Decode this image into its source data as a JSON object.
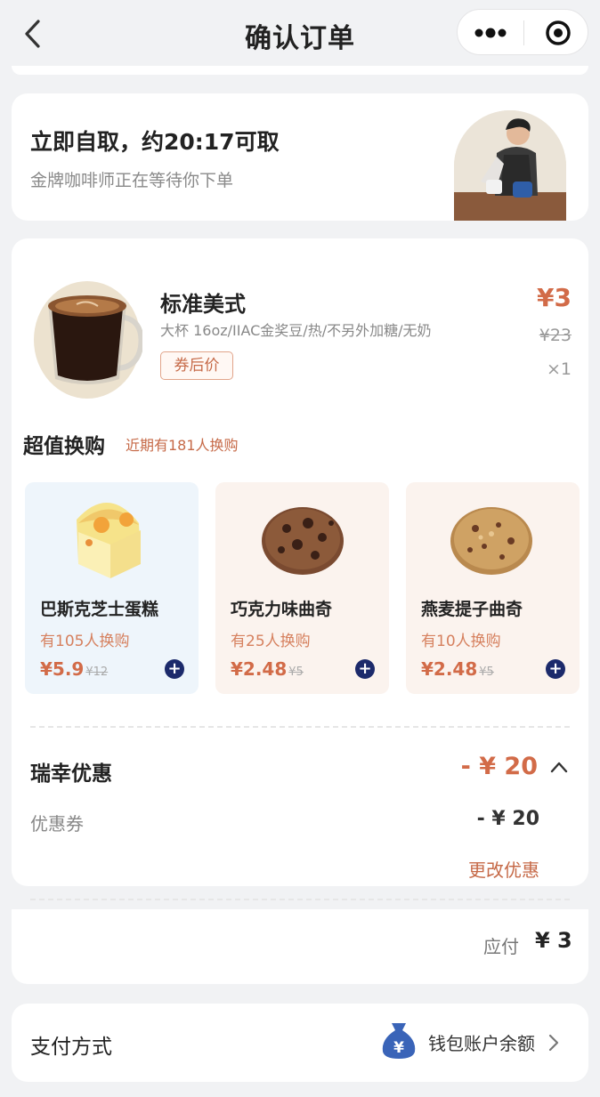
{
  "header": {
    "title": "确认订单"
  },
  "pickup": {
    "title": "立即自取，约20:17可取",
    "subtitle": "金牌咖啡师正在等待你下单"
  },
  "product": {
    "name": "标准美式",
    "spec": "大杯 16oz/IIAC金奖豆/热/不另外加糖/无奶",
    "tag": "券后价",
    "price": "¥3",
    "original_price": "¥23",
    "quantity": "×1"
  },
  "addons": {
    "title": "超值换购",
    "note": "近期有181人换购",
    "items": [
      {
        "name": "巴斯克芝士蛋糕",
        "count": "有105人换购",
        "price": "¥5.9",
        "original_price": "¥12",
        "bg": "#eef5fb"
      },
      {
        "name": "巧克力味曲奇",
        "count": "有25人换购",
        "price": "¥2.48",
        "original_price": "¥5",
        "bg": "#fbf3ee"
      },
      {
        "name": "燕麦提子曲奇",
        "count": "有10人换购",
        "price": "¥2.48",
        "original_price": "¥5",
        "bg": "#fbf3ee"
      }
    ]
  },
  "discount": {
    "title": "瑞幸优惠",
    "total": "- ¥ 20",
    "coupon_label": "优惠券",
    "coupon_value": "- ¥ 20",
    "change_label": "更改优惠"
  },
  "summary": {
    "due_label": "应付",
    "due_value": "¥ 3"
  },
  "payment": {
    "label": "支付方式",
    "method": "钱包账户余额",
    "wallet_glyph": "¥"
  },
  "colors": {
    "accent": "#d26b48",
    "plus_button": "#1c2a6b",
    "wallet_icon": "#3a64b8"
  }
}
